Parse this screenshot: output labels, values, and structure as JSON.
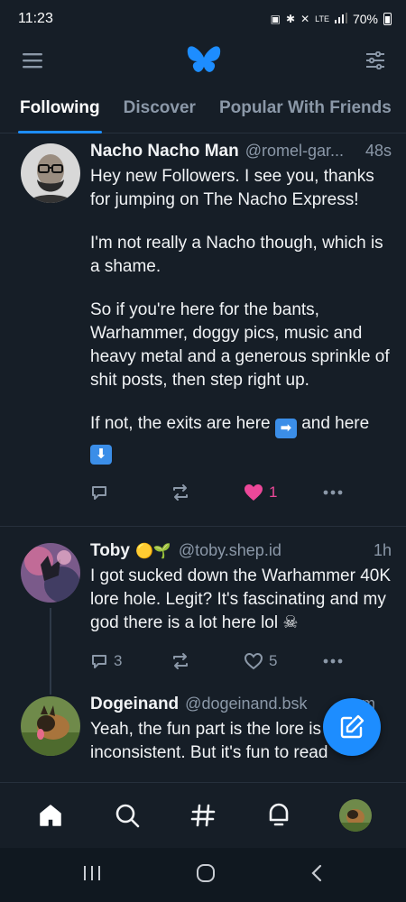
{
  "status_bar": {
    "time": "11:23",
    "network": "LTE",
    "battery": "70%",
    "icons": [
      "lock-icon",
      "bluetooth-icon",
      "mute-icon",
      "lte-signal-icon",
      "signal-bars-icon",
      "battery-icon"
    ]
  },
  "header": {
    "menu_icon": "hamburger-menu-icon",
    "logo_icon": "butterfly-logo-icon",
    "feeds_icon": "sliders-icon",
    "brand_color": "#1d8dff"
  },
  "tabs": [
    {
      "label": "Following",
      "active": true
    },
    {
      "label": "Discover",
      "active": false
    },
    {
      "label": "Popular With Friends",
      "active": false
    }
  ],
  "posts": [
    {
      "name": "Nacho Nacho Man",
      "handle": "@romel-gar...",
      "time": "48s",
      "paragraphs": [
        "Hey new Followers. I see you, thanks for jumping on The Nacho Express!",
        "I'm not really a Nacho though, which is a shame.",
        "So if you're here for the bants, Warhammer,  doggy pics, music and heavy metal and a generous sprinkle of shit posts, then step right up."
      ],
      "last_line": "If not, the exits are here",
      "last_line_mid": "and here",
      "emoji_right": "➡",
      "emoji_down": "⬇",
      "replies": "",
      "reposts": "",
      "likes": "1",
      "liked": true
    },
    {
      "name": "Toby",
      "name_emoji": "🟡🌱",
      "handle": "@toby.shep.id",
      "time": "1h",
      "text": "I got sucked down the Warhammer 40K lore hole. Legit? It's fascinating and my god there is a lot here lol",
      "text_emoji": "☠",
      "replies": "3",
      "reposts": "",
      "likes": "5",
      "liked": false
    },
    {
      "name": "Dogeinand",
      "handle": "@dogeinand.bsk",
      "time_partial": "m",
      "text": "Yeah, the fun part is the lore is wildly inconsistent. But it's fun to read"
    }
  ],
  "compose_button_icon": "compose-pencil-icon",
  "bottom_nav": [
    "home-icon",
    "search-icon",
    "hashtag-feeds-icon",
    "notifications-icon",
    "profile-avatar"
  ],
  "system_nav": [
    "recent-apps-icon",
    "home-circle-icon",
    "back-chevron-icon"
  ],
  "colors": {
    "background": "#161e27",
    "divider": "#26303c",
    "muted_text": "#8b98a8",
    "like_pink": "#ec4899",
    "accent": "#1d8dff"
  }
}
